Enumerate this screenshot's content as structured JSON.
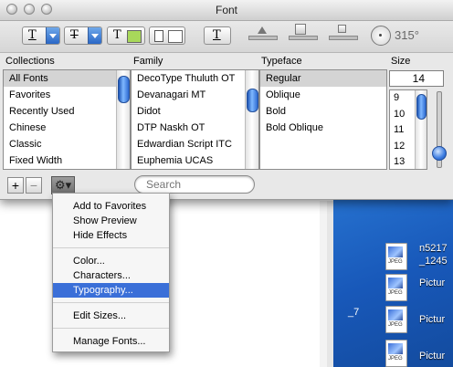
{
  "window": {
    "title": "Font"
  },
  "toolbar": {
    "underline_glyph": "T",
    "strike_glyph": "T",
    "text_color_glyph": "T",
    "doc_color_glyph": "",
    "shadow_glyph": "T",
    "angle": "315°"
  },
  "columns": {
    "collections": "Collections",
    "family": "Family",
    "typeface": "Typeface",
    "size": "Size"
  },
  "collections": [
    "All Fonts",
    "Favorites",
    "Recently Used",
    "Chinese",
    "Classic",
    "Fixed Width"
  ],
  "families": [
    "DecoType Thuluth OT",
    "Devanagari MT",
    "Didot",
    "DTP Naskh OT",
    "Edwardian Script ITC",
    "Euphemia UCAS"
  ],
  "typefaces": [
    "Regular",
    "Oblique",
    "Bold",
    "Bold Oblique"
  ],
  "size": {
    "value": "14",
    "options": [
      "9",
      "10",
      "11",
      "12",
      "13"
    ]
  },
  "bottom": {
    "add_label": "+",
    "remove_label": "−",
    "action_label": "⚙▾",
    "search_placeholder": "Search"
  },
  "menu": {
    "items": [
      "Add to Favorites",
      "Show Preview",
      "Hide Effects",
      "Color...",
      "Characters...",
      "Typography...",
      "Edit Sizes...",
      "Manage Fonts..."
    ],
    "highlighted": "Typography..."
  },
  "desktop": {
    "files": [
      "n5217_1245",
      "Pictur",
      "Pictur",
      "Pictur"
    ],
    "file_name_lines": [
      "n5217",
      "_1245"
    ],
    "icon_tag": "JPEG",
    "side_text": "_7"
  },
  "colors": {
    "accent": "#3a6fd8",
    "text_color_swatch": "#a8d85a",
    "desktop_blue": "#1a63c7"
  }
}
